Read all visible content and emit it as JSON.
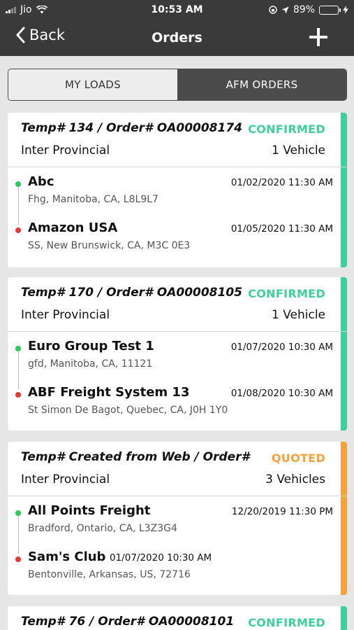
{
  "status_bar": {
    "carrier": "Jio",
    "time": "10:53 AM",
    "battery_percent": "89%",
    "battery_level": 0.89,
    "battery_color": "#4cd964"
  },
  "nav": {
    "back_label": "Back",
    "title": "Orders",
    "add_icon": "plus-icon"
  },
  "tabs": [
    {
      "label": "MY LOADS",
      "active": false
    },
    {
      "label": "AFM ORDERS",
      "active": true
    }
  ],
  "colors": {
    "confirmed": "#3ecf9a",
    "quoted": "#f5a23d",
    "pickup_dot": "#2ec95c",
    "dropoff_dot": "#e53935"
  },
  "orders": [
    {
      "title": "Temp# 134 / Order# OA00008174",
      "status": "CONFIRMED",
      "type": "Inter Provincial",
      "vehicles": "1 Vehicle",
      "pickup": {
        "name": "Abc",
        "date": "01/02/2020 11:30 AM",
        "address": "Fhg, Manitoba, CA, L8L9L7"
      },
      "dropoff": {
        "name": "Amazon USA",
        "date": "01/05/2020 11:30 AM",
        "address": "SS, New Brunswick, CA, M3C 0E3"
      }
    },
    {
      "title": "Temp# 170 / Order# OA00008105",
      "status": "CONFIRMED",
      "type": "Inter Provincial",
      "vehicles": "1 Vehicle",
      "pickup": {
        "name": "Euro Group Test 1",
        "date": "01/07/2020 10:30 AM",
        "address": "gfd, Manitoba, CA, 11121"
      },
      "dropoff": {
        "name": "ABF Freight System 13",
        "date": "01/08/2020 10:30 AM",
        "address": "St Simon De Bagot, Quebec, CA, J0H 1Y0"
      }
    },
    {
      "title": "Temp# Created from Web / Order# T…",
      "status": "QUOTED",
      "type": "Inter Provincial",
      "vehicles": "3 Vehicles",
      "pickup": {
        "name": "All Points Freight",
        "date": "12/20/2019 11:30 PM",
        "address": "Bradford, Ontario, CA, L3Z3G4"
      },
      "dropoff": {
        "name": "Sam's Club",
        "date": "01/07/2020 10:30 AM",
        "address": "Bentonville, Arkansas, US, 72716"
      }
    },
    {
      "title": "Temp# 76 / Order# OA00008101",
      "status": "CONFIRMED"
    }
  ]
}
